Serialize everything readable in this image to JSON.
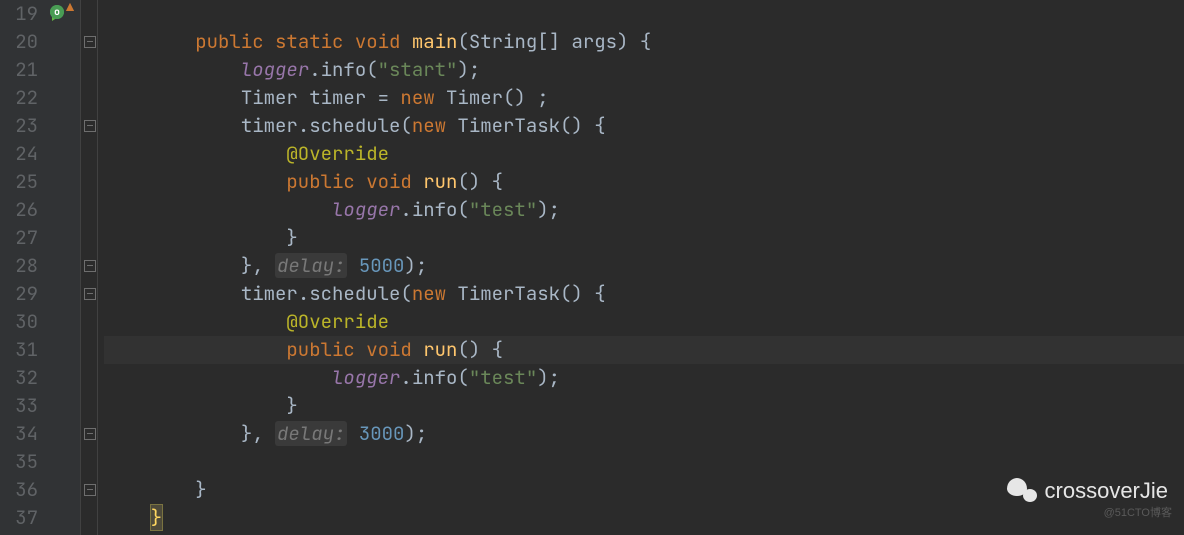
{
  "lines": {
    "start": 19,
    "end": 37
  },
  "code": {
    "l20": {
      "kw_public": "public",
      "kw_static": "static",
      "kw_void": "void",
      "method": "main",
      "args": "(String[] args) {"
    },
    "l21": {
      "obj": "logger",
      "call": ".info(",
      "str": "\"start\"",
      "end": ");"
    },
    "l22": {
      "t1": "Timer timer = ",
      "kw": "new",
      "t2": " Timer() ;"
    },
    "l23": {
      "t1": "timer.schedule(",
      "kw": "new",
      "t2": " TimerTask() {"
    },
    "l24": {
      "anno": "@Override"
    },
    "l25": {
      "kw_public": "public",
      "kw_void": "void",
      "method": "run",
      "sig": "() {"
    },
    "l26": {
      "obj": "logger",
      "call": ".info(",
      "str": "\"test\"",
      "end": ");"
    },
    "l27": {
      "brace": "}"
    },
    "l28": {
      "t1": "}, ",
      "hint": "delay:",
      "num": " 5000",
      "end": ");"
    },
    "l29": {
      "t1": "timer.schedule(",
      "kw": "new",
      "t2": " TimerTask() {"
    },
    "l30": {
      "anno": "@Override"
    },
    "l31": {
      "kw_public": "public",
      "kw_void": "void",
      "method": "run",
      "sig": "() {"
    },
    "l32": {
      "obj": "logger",
      "call": ".info(",
      "str": "\"test\"",
      "end": ");"
    },
    "l33": {
      "brace": "}"
    },
    "l34": {
      "t1": "}, ",
      "hint": "delay:",
      "num": " 3000",
      "end": ");"
    },
    "l36": {
      "brace": "}"
    },
    "l37": {
      "brace": "}"
    }
  },
  "watermark": "crossoverJie",
  "cto": "@51CTO博客"
}
